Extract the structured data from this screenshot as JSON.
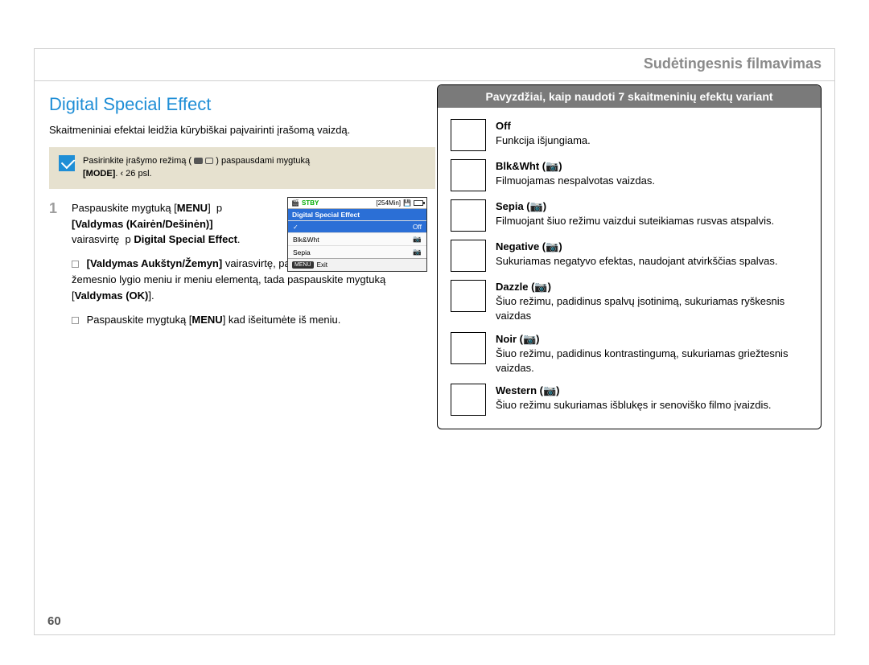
{
  "header": {
    "title": "Sudėtingesnis filmavimas"
  },
  "page_number": "60",
  "left": {
    "section_title": "Digital Special Effect",
    "intro": "Skaitmeniniai efektai leidžia kūrybiškai paįvairinti įrašomą vaizdą.",
    "note": {
      "pre": "Pasirinkite įrašymo režimą (",
      "post": ") paspausdami mygtuką",
      "mode_label": "[MODE]",
      "page_ref": ". ‹ 26 psl."
    },
    "step1": {
      "num": "1",
      "t1": "Paspauskite mygtuką [",
      "t2": "MENU",
      "t3": "]  p",
      "line2": "[Valdymas (Kairėn/Dešinėn)]",
      "line3_pre": "vairasvirtę  p ",
      "line3_bold": "Digital Special Effect",
      "line3_post": "."
    },
    "sub1": {
      "b1": "[Valdymas Aukštyn/Žemyn]",
      "t1": " vairasvirtę, pasirinkite pageidaujamą žemesnio lygio meniu ir meniu elementą, tada paspauskite mygtuką [",
      "b2": "Valdymas (OK)",
      "t2": "]."
    },
    "sub2": {
      "t1": "Paspauskite mygtuką [",
      "b1": "MENU",
      "t2": "] kad išeitumėte iš meniu."
    },
    "cam": {
      "stby": "STBY",
      "time": "[254Min]",
      "title": "Digital Special Effect",
      "opt1": "Off",
      "opt2": "Blk&Wht",
      "opt3": "Sepia",
      "menu": "MENU",
      "exit": "Exit"
    }
  },
  "right": {
    "panel_title": "Pavyzdžiai, kaip naudoti 7 skaitmeninių efektų variant",
    "effects": [
      {
        "title": "Off",
        "desc": "Funkcija išjungiama."
      },
      {
        "title": "Blk&Wht (📷)",
        "desc": "Filmuojamas nespalvotas vaizdas."
      },
      {
        "title": "Sepia (📷)",
        "desc": "Filmuojant šiuo režimu vaizdui suteikiamas rusvas atspalvis."
      },
      {
        "title": "Negative (📷)",
        "desc": "Sukuriamas negatyvo efektas, naudojant atvirkščias spalvas."
      },
      {
        "title": "Dazzle (📷)",
        "desc": "Šiuo režimu, padidinus spalvų įsotinimą, sukuriamas ryškesnis vaizdas"
      },
      {
        "title": "Noir (📷)",
        "desc": "Šiuo režimu, padidinus kontrastingumą, sukuriamas griežtesnis vaizdas."
      },
      {
        "title": "Western (📷)",
        "desc": "Šiuo režimu sukuriamas išblukęs ir senoviško filmo įvaizdis."
      }
    ]
  }
}
